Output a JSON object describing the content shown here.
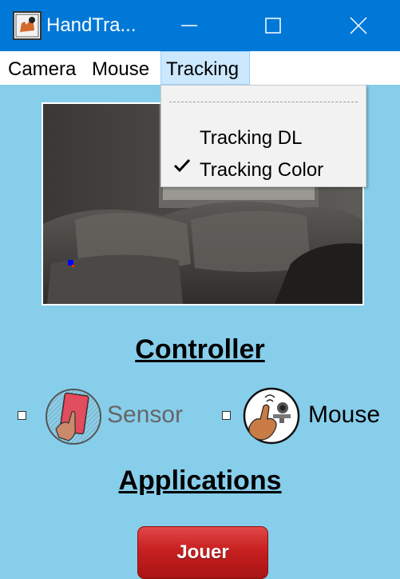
{
  "window": {
    "title": "HandTra...",
    "app_icon": "app-logo-icon",
    "controls": [
      "minimize-icon",
      "maximize-icon",
      "close-icon"
    ]
  },
  "menubar": {
    "items": [
      {
        "label": "Camera"
      },
      {
        "label": "Mouse"
      },
      {
        "label": "Tracking",
        "open": true
      }
    ]
  },
  "tracking_menu": {
    "items": [
      {
        "label": "Tracking DL",
        "checked": false
      },
      {
        "label": "Tracking Color",
        "checked": true
      }
    ]
  },
  "camera_view": {
    "content": "webcam-feed"
  },
  "controller": {
    "heading": "Controller",
    "options": [
      {
        "label": "Sensor",
        "icon": "hand-sensor-icon",
        "checked": false,
        "enabled": false
      },
      {
        "label": "Mouse",
        "icon": "hand-mouse-icon",
        "checked": false,
        "enabled": true
      }
    ]
  },
  "applications": {
    "heading": "Applications",
    "play_button": "Jouer"
  },
  "colors": {
    "titlebar": "#0078D7",
    "background": "#87CEEB",
    "menu_highlight": "#CCE8FF",
    "play_button": "#C82020"
  }
}
